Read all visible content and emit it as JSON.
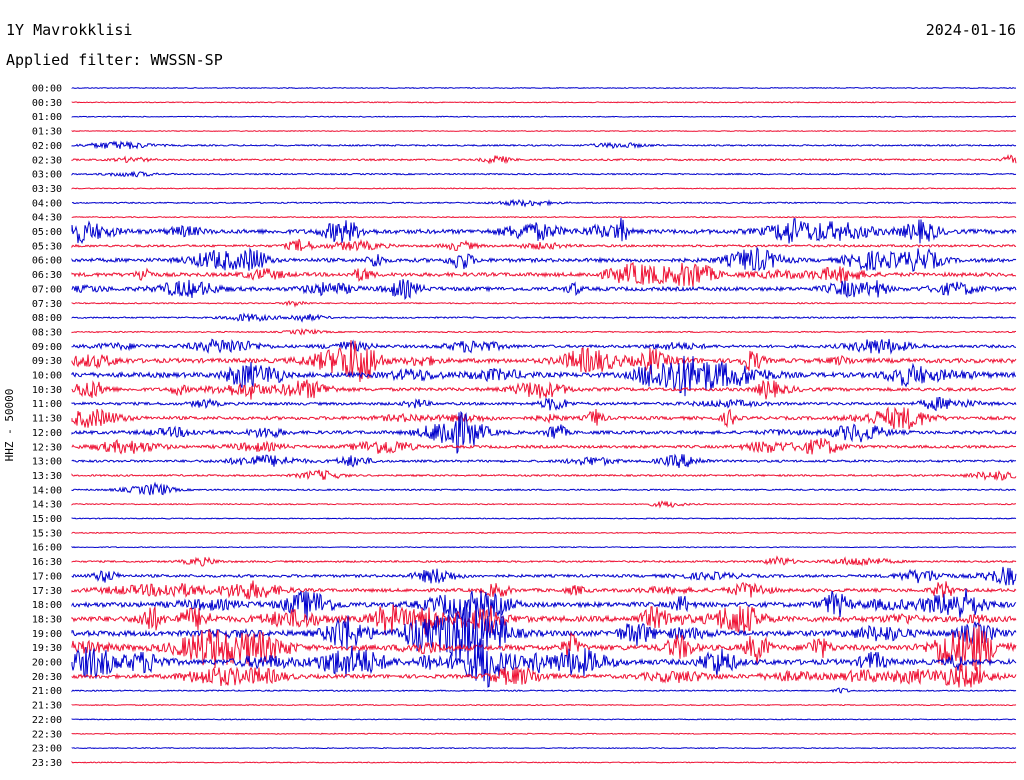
{
  "header": {
    "station": "1Y Mavrokklisi",
    "date": "2024-01-16",
    "filter_label": "Applied filter: WWSSN-SP"
  },
  "colors": {
    "trace_a": "#0000cc",
    "trace_b": "#ee1133",
    "background": "#ffffff",
    "text": "#000000"
  },
  "chart_data": {
    "type": "line",
    "title": "",
    "xlabel": "",
    "ylabel": "HHZ - 50000",
    "color_cycle": [
      "#0000cc",
      "#ee1133"
    ],
    "row_labels": [
      "00:00",
      "00:30",
      "01:00",
      "01:30",
      "02:00",
      "02:30",
      "03:00",
      "03:30",
      "04:00",
      "04:30",
      "05:00",
      "05:30",
      "06:00",
      "06:30",
      "07:00",
      "07:30",
      "08:00",
      "08:30",
      "09:00",
      "09:30",
      "10:00",
      "10:30",
      "11:00",
      "11:30",
      "12:00",
      "12:30",
      "13:00",
      "13:30",
      "14:00",
      "14:30",
      "15:00",
      "15:30",
      "16:00",
      "16:30",
      "17:00",
      "17:30",
      "18:00",
      "18:30",
      "19:00",
      "19:30",
      "20:00",
      "20:30",
      "21:00",
      "21:30",
      "22:00",
      "22:30",
      "23:00",
      "23:30"
    ],
    "activity_level": [
      0.3,
      0.4,
      0.3,
      0.2,
      1.5,
      2,
      1.2,
      0.4,
      1,
      0.6,
      7,
      3,
      6,
      6,
      6,
      1,
      1.5,
      1,
      4,
      7,
      8,
      5,
      4,
      5,
      5,
      4,
      3,
      2,
      1.5,
      0.8,
      0.5,
      0.6,
      0.4,
      2,
      4,
      5,
      8,
      9,
      9,
      9,
      9,
      6,
      1,
      0.6,
      0.3,
      0.4,
      0.3,
      0.3
    ]
  }
}
